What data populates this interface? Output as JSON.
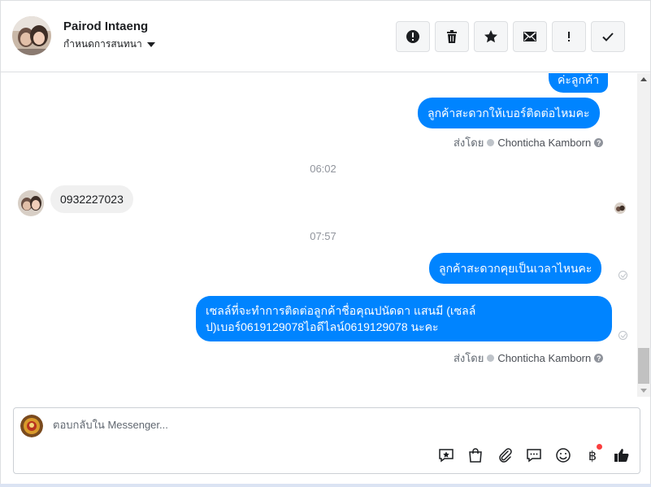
{
  "header": {
    "contact_name": "Pairod Intaeng",
    "assign_label": "กำหนดการสนทนา"
  },
  "actions": [
    {
      "name": "mark-spam",
      "icon": "alert-circle-icon"
    },
    {
      "name": "delete",
      "icon": "trash-icon"
    },
    {
      "name": "star",
      "icon": "star-icon"
    },
    {
      "name": "mark-unread",
      "icon": "envelope-icon"
    },
    {
      "name": "follow-up",
      "icon": "exclamation-icon"
    },
    {
      "name": "done",
      "icon": "check-icon"
    }
  ],
  "messages": {
    "m1": "ค่ะลูกค้า",
    "m2": "ลูกค้าสะดวกให้เบอร์ติดต่อไหมคะ",
    "sent_by_1": "ส่งโดย",
    "agent_1": "Chonticha Kamborn",
    "time_1": "06:02",
    "m3": "0932227023",
    "time_2": "07:57",
    "m4": "ลูกค้าสะดวกคุยเป็นเวลาไหนคะ",
    "m5_line1": "เซลล์ที่จะทำการติดต่อลูกค้าชื่อคุณปนัดดา แสนมี (เซลล์",
    "m5_line2": "ป)เบอร์0619129078ไอดีไลน์0619129078 นะคะ",
    "sent_by_2": "ส่งโดย",
    "agent_2": "Chonticha Kamborn"
  },
  "composer": {
    "placeholder": "ตอบกลับใน Messenger..."
  },
  "composer_tools": [
    "saved-reply-icon",
    "shop-bag-icon",
    "paperclip-icon",
    "chat-bubble-icon",
    "emoji-icon",
    "baht-payment-icon",
    "thumbs-up-icon"
  ],
  "colors": {
    "brand_blue": "#0084ff",
    "incoming_bubble": "#f0f0f0",
    "notification_dot": "#fa3e3e"
  }
}
